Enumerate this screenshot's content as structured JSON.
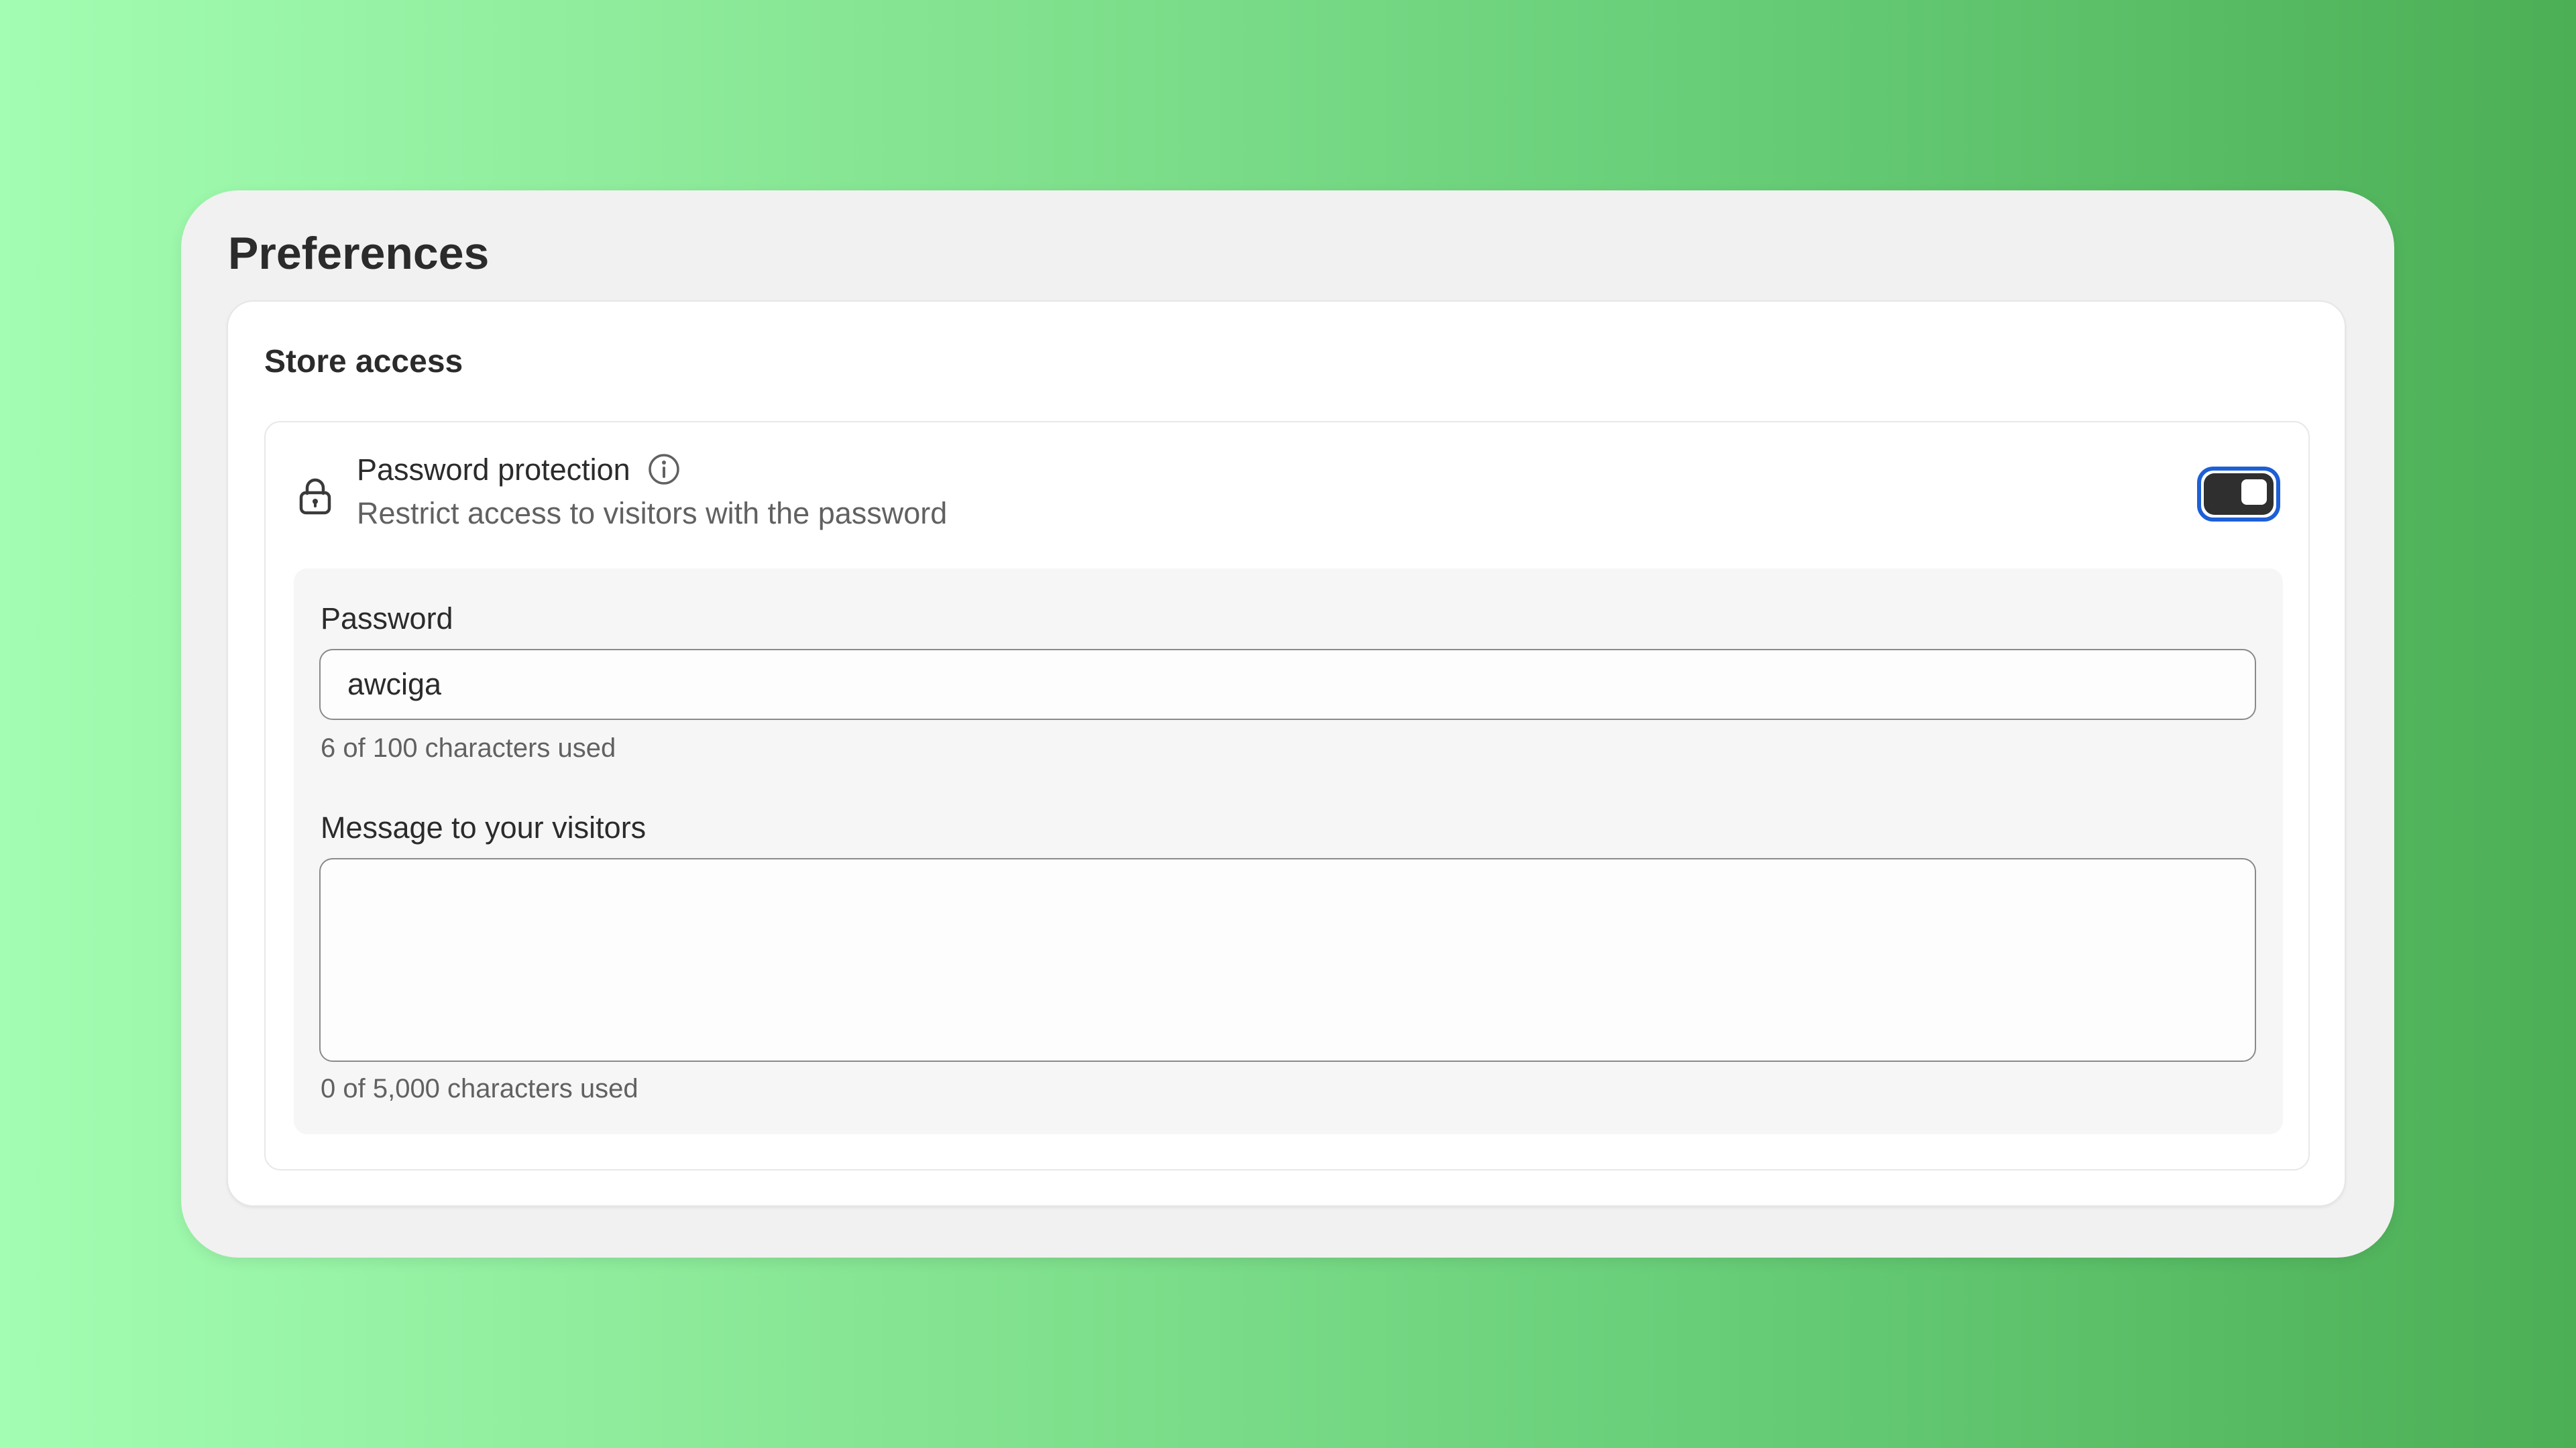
{
  "page": {
    "title": "Preferences"
  },
  "store_access": {
    "title": "Store access",
    "password_protection": {
      "title": "Password protection",
      "description": "Restrict access to visitors with the password",
      "enabled": true,
      "lock_icon": "lock-icon",
      "info_icon": "info-icon"
    },
    "password_field": {
      "label": "Password",
      "value": "awciga",
      "help": "6 of 100 characters used"
    },
    "message_field": {
      "label": "Message to your visitors",
      "value": "",
      "help": "0 of 5,000 characters used"
    }
  },
  "colors": {
    "background_gradient_start": "#a3fdb2",
    "background_gradient_end": "#4caf56",
    "panel": "#f1f1f1",
    "card": "#ffffff",
    "toggle_on": "#2f2f2f",
    "focus_ring": "#1d5fd6"
  }
}
